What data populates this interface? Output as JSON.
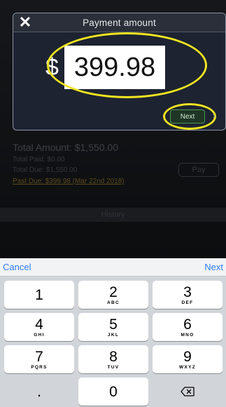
{
  "background": {
    "total_amount": "Total Amount: $1,550.00",
    "total_paid": "Total Paid: $0.00",
    "total_due": "Total Due: $1,550.00",
    "past_due": "Past Due: $399.98 (Mar 22nd 2018)",
    "pay_label": "Pay",
    "history_label": "History"
  },
  "modal": {
    "title": "Payment amount",
    "close_glyph": "✕",
    "currency_symbol": "$",
    "amount_value": "399.98",
    "next_label": "Next",
    "chevron": "›"
  },
  "keyboard": {
    "cancel_label": "Cancel",
    "next_label": "Next",
    "keys": [
      {
        "digit": "1",
        "letters": ""
      },
      {
        "digit": "2",
        "letters": "ABC"
      },
      {
        "digit": "3",
        "letters": "DEF"
      },
      {
        "digit": "4",
        "letters": "GHI"
      },
      {
        "digit": "5",
        "letters": "JKL"
      },
      {
        "digit": "6",
        "letters": "MNO"
      },
      {
        "digit": "7",
        "letters": "PQRS"
      },
      {
        "digit": "8",
        "letters": "TUV"
      },
      {
        "digit": "9",
        "letters": "WXYZ"
      },
      {
        "digit": ".",
        "letters": ""
      },
      {
        "digit": "0",
        "letters": ""
      }
    ],
    "delete_icon": "backspace-icon"
  },
  "colors": {
    "highlight": "#f0e41f",
    "accent_blue": "#2f7cf6",
    "next_green": "#4b9a4f"
  }
}
